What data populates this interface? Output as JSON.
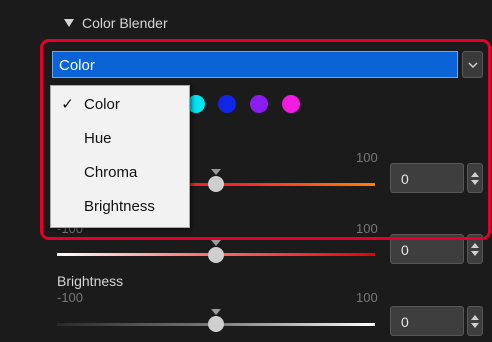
{
  "panel": {
    "title": "Color Blender"
  },
  "mode_select": {
    "value": "Color"
  },
  "dropdown": {
    "items": [
      {
        "label": "Color",
        "checked": true
      },
      {
        "label": "Hue",
        "checked": false
      },
      {
        "label": "Chroma",
        "checked": false
      },
      {
        "label": "Brightness",
        "checked": false
      }
    ],
    "check_glyph": "✓"
  },
  "swatches": [
    {
      "name": "cyan",
      "color": "#00e5f2"
    },
    {
      "name": "blue",
      "color": "#1226e8"
    },
    {
      "name": "purple",
      "color": "#8a1cf0"
    },
    {
      "name": "magenta",
      "color": "#f21be0"
    }
  ],
  "sliders": {
    "slider1": {
      "max_label": "100",
      "value": "0",
      "level": 0.5
    },
    "slider2": {
      "min_label": "-100",
      "max_label": "100",
      "value": "0",
      "level": 0.5
    },
    "brightness": {
      "label": "Brightness",
      "min_label": "-100",
      "max_label": "100",
      "value": "0",
      "level": 0.5
    }
  },
  "colors": {
    "selection": "#0a63d6",
    "highlight_frame": "#e4002b"
  }
}
